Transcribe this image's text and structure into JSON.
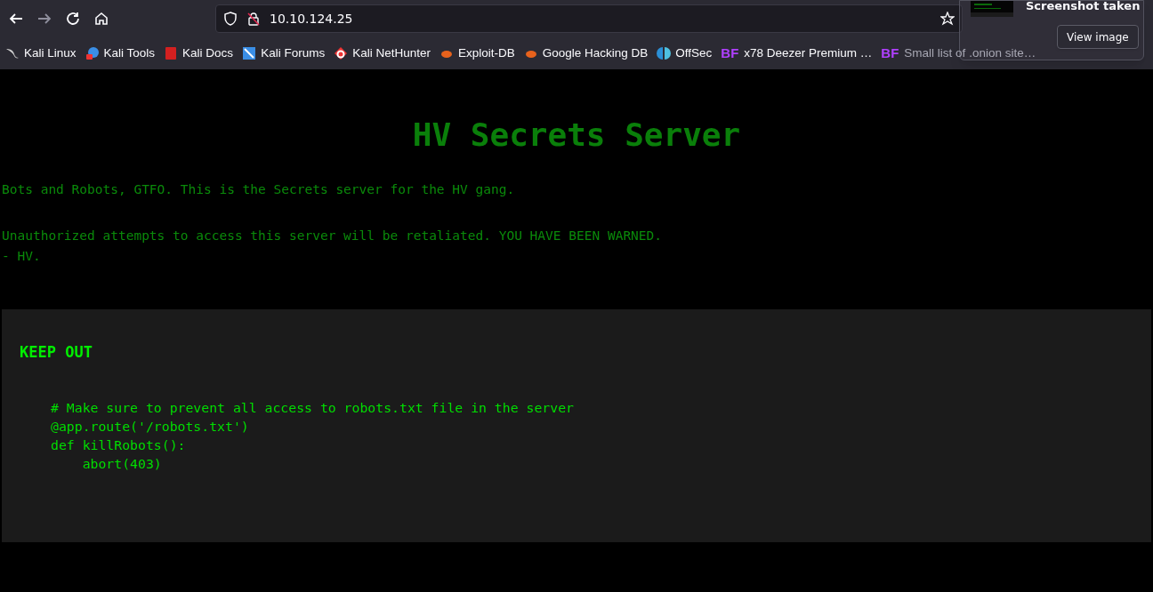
{
  "toolbar": {
    "url": "10.10.124.25"
  },
  "bookmarks": [
    {
      "label": "Kali Linux"
    },
    {
      "label": "Kali Tools"
    },
    {
      "label": "Kali Docs"
    },
    {
      "label": "Kali Forums"
    },
    {
      "label": "Kali NetHunter"
    },
    {
      "label": "Exploit-DB"
    },
    {
      "label": "Google Hacking DB"
    },
    {
      "label": "OffSec"
    },
    {
      "label": "x78 Deezer Premium …",
      "badge": "BF"
    },
    {
      "label": "Small list of .onion site…",
      "badge": "BF"
    }
  ],
  "notification": {
    "title": "Screenshot taken",
    "button": "View image"
  },
  "page": {
    "heading": "HV Secrets Server",
    "paragraphs": [
      [
        "Bots and Robots, GTFO. This is the Secrets server for the HV gang."
      ],
      [
        "Unauthorized attempts to access this server will be retaliated. YOU HAVE BEEN WARNED.",
        "- HV."
      ]
    ],
    "panel": {
      "title": "KEEP OUT",
      "code": [
        "# Make sure to prevent all access to robots.txt file in the server",
        "@app.route('/robots.txt')",
        "def killRobots():",
        "    abort(403)"
      ]
    }
  }
}
